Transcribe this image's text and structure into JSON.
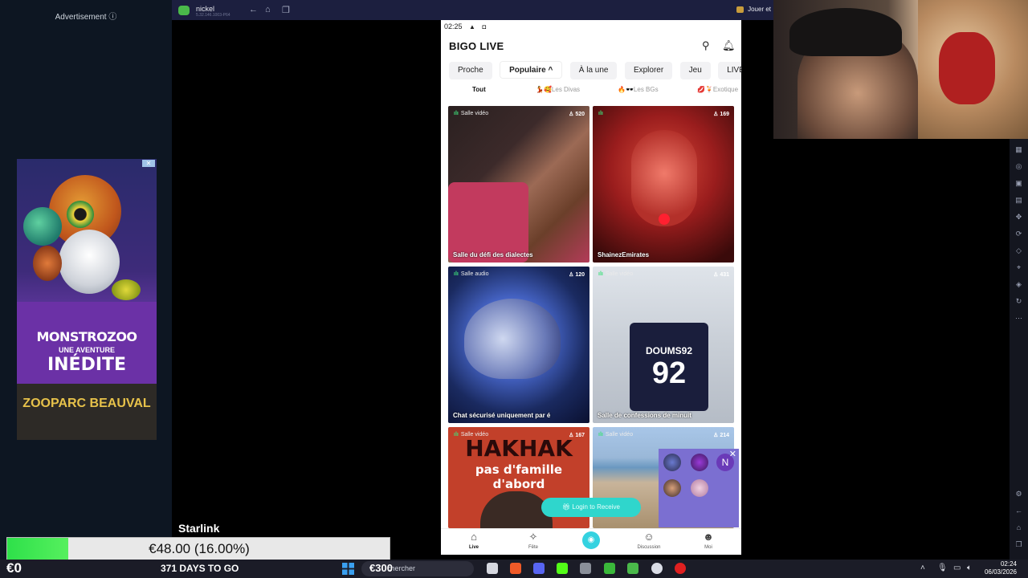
{
  "ad": {
    "label": "Advertisement ⓘ",
    "promo_line1": "MONSTROZOO",
    "promo_line2": "UNE AVENTURE",
    "promo_line3": "INÉDITE",
    "brand": "ZOOPARC BEAUVAL"
  },
  "emulator": {
    "app_title": "nickel",
    "app_subtitle": "5.32.146.1003-P64",
    "play_label": "Jouer et"
  },
  "phone": {
    "status_time": "02:25",
    "brand": "BIGO LIVE",
    "tabs": [
      "Proche",
      "Populaire ^",
      "À la une",
      "Explorer",
      "Jeu",
      "LIVE Virtuel"
    ],
    "subtabs": [
      "Tout",
      "💃🥰Les Divas",
      "🔥🕶️Les BGs",
      "💋🍹Exotique"
    ],
    "cards": [
      {
        "tag": "Salle vidéo",
        "viewers": "520",
        "name": "Salle du défi des dialectes"
      },
      {
        "tag": "",
        "viewers": "169",
        "name": "ShainezEmirates"
      },
      {
        "tag": "Salle audio",
        "viewers": "120",
        "name": "Chat sécurisé uniquement par é"
      },
      {
        "tag": "Salle vidéo",
        "viewers": "431",
        "name": "Salle de confessions de minuit"
      },
      {
        "tag": "Salle vidéo",
        "viewers": "167",
        "name": ""
      },
      {
        "tag": "Salle vidéo",
        "viewers": "214",
        "name": ""
      }
    ],
    "card3_overlay_1": "HAKHAK",
    "card3_overlay_2": "pas d'famille d'abord",
    "card4_shirt_name": "DOUMS92",
    "card4_shirt_number": "92",
    "login_pill": "Login to Receive",
    "mini_initial": "N",
    "nav": [
      "Live",
      "Fête",
      "Discussion",
      "Moi"
    ]
  },
  "overlay": {
    "starlink": "Starlink",
    "goal_text": "€48.00 (16.00%)",
    "goal_progress": 0.16
  },
  "taskbar": {
    "money": "€0",
    "days": "371 DAYS TO GO",
    "search_amount": "€300",
    "search_placeholder": "chercher",
    "time": "02:24",
    "date": "06/03/2026"
  },
  "colors": {
    "accent_teal": "#2fd6cc",
    "goal_green": "#2ee04a",
    "taskbar_bg": "#1b1c27"
  }
}
